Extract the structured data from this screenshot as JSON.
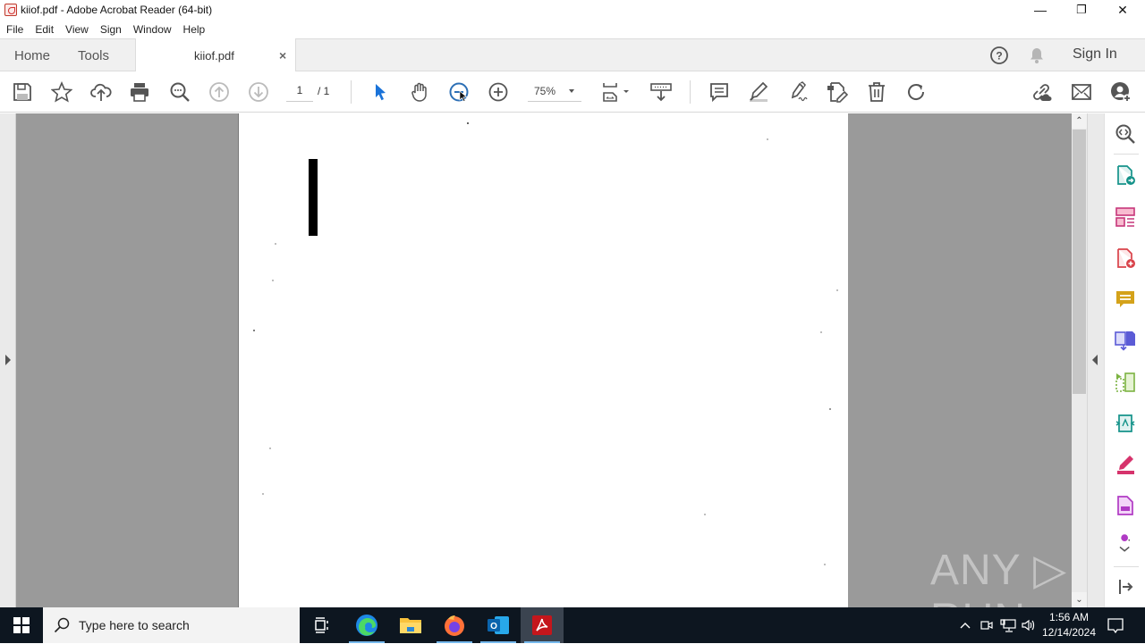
{
  "window": {
    "title": "kiiof.pdf - Adobe Acrobat Reader (64-bit)",
    "controls": {
      "minimize": "—",
      "restore": "❐",
      "close": "✕"
    }
  },
  "menu": [
    "File",
    "Edit",
    "View",
    "Sign",
    "Window",
    "Help"
  ],
  "tabs": {
    "home": "Home",
    "tools": "Tools",
    "document": "kiiof.pdf",
    "close_glyph": "×",
    "sign_in": "Sign In"
  },
  "toolbar": {
    "page_current": "1",
    "page_total": "/ 1",
    "zoom": "75%",
    "tools": [
      "save",
      "bookmark",
      "upload-cloud",
      "print",
      "find",
      "prev-page",
      "next-page",
      "select",
      "hand",
      "zoom-out",
      "zoom-in",
      "zoom-level",
      "page-fit",
      "scroll-mode",
      "comment",
      "highlight",
      "sign",
      "edit-pdf",
      "delete",
      "rotate",
      "share-link",
      "email",
      "add-user"
    ]
  },
  "right_rail": [
    "search-enhance",
    "export-pdf",
    "organize-pages",
    "create-pdf",
    "comment",
    "combine-files",
    "compress",
    "edit-pdf",
    "fill-sign",
    "protect",
    "more-tools",
    "collapse"
  ],
  "right_rail_colors": {
    "export": "#15938a",
    "organize": "#c6367a",
    "create": "#d9434a",
    "comment": "#d4a21a",
    "combine": "#5b5bd6",
    "compress": "#7cb342",
    "edit": "#15938a",
    "fill_sign": "#d6336c",
    "protect": "#b03ac4"
  },
  "watermark": "ANY ▷ RUN",
  "taskbar": {
    "search_placeholder": "Type here to search",
    "apps": [
      "task-view",
      "edge",
      "file-explorer",
      "firefox",
      "outlook",
      "acrobat"
    ],
    "time": "1:56 AM",
    "date": "12/14/2024"
  }
}
